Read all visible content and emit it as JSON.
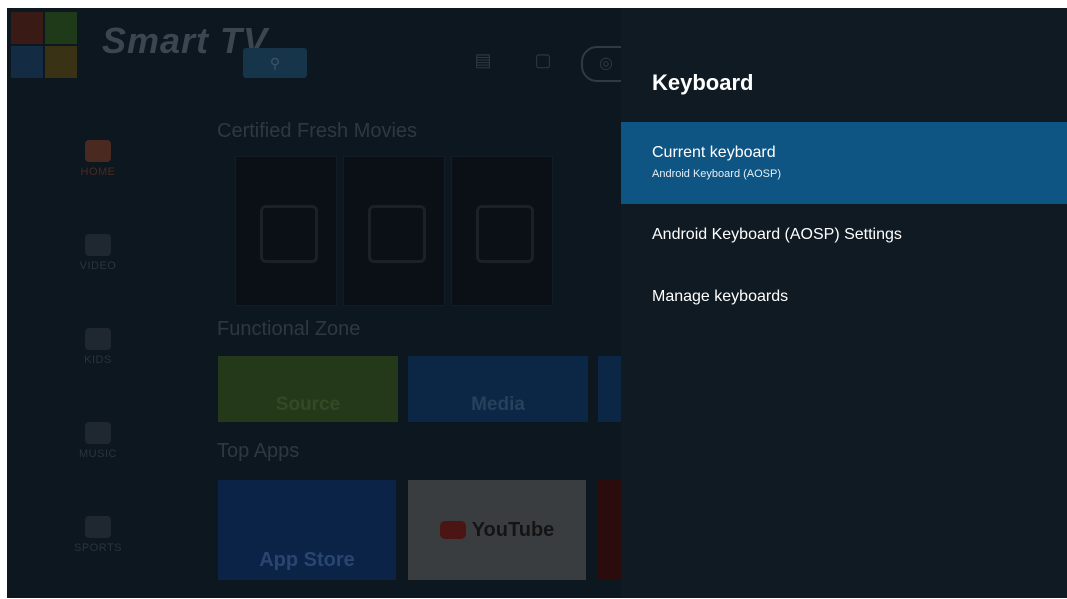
{
  "background": {
    "brand": "Smart TV",
    "sidebar": [
      {
        "label": "HOME",
        "active": true
      },
      {
        "label": "VIDEO",
        "active": false
      },
      {
        "label": "KIDS",
        "active": false
      },
      {
        "label": "MUSIC",
        "active": false
      },
      {
        "label": "SPORTS",
        "active": false
      }
    ],
    "sections": {
      "movies": "Certified Fresh Movies",
      "functional": "Functional Zone",
      "apps": "Top Apps"
    },
    "functional_tiles": [
      "Source",
      "Media"
    ],
    "app_tiles": [
      "App Store",
      "YouTube"
    ]
  },
  "panel": {
    "title": "Keyboard",
    "items": [
      {
        "label": "Current keyboard",
        "sublabel": "Android Keyboard (AOSP)",
        "selected": true
      },
      {
        "label": "Android Keyboard (AOSP) Settings",
        "sublabel": "",
        "selected": false
      },
      {
        "label": "Manage keyboards",
        "sublabel": "",
        "selected": false
      }
    ]
  },
  "colors": {
    "panel_bg": "#0f1a23",
    "selection": "#0f5584",
    "youtube_red": "#c0201a"
  }
}
